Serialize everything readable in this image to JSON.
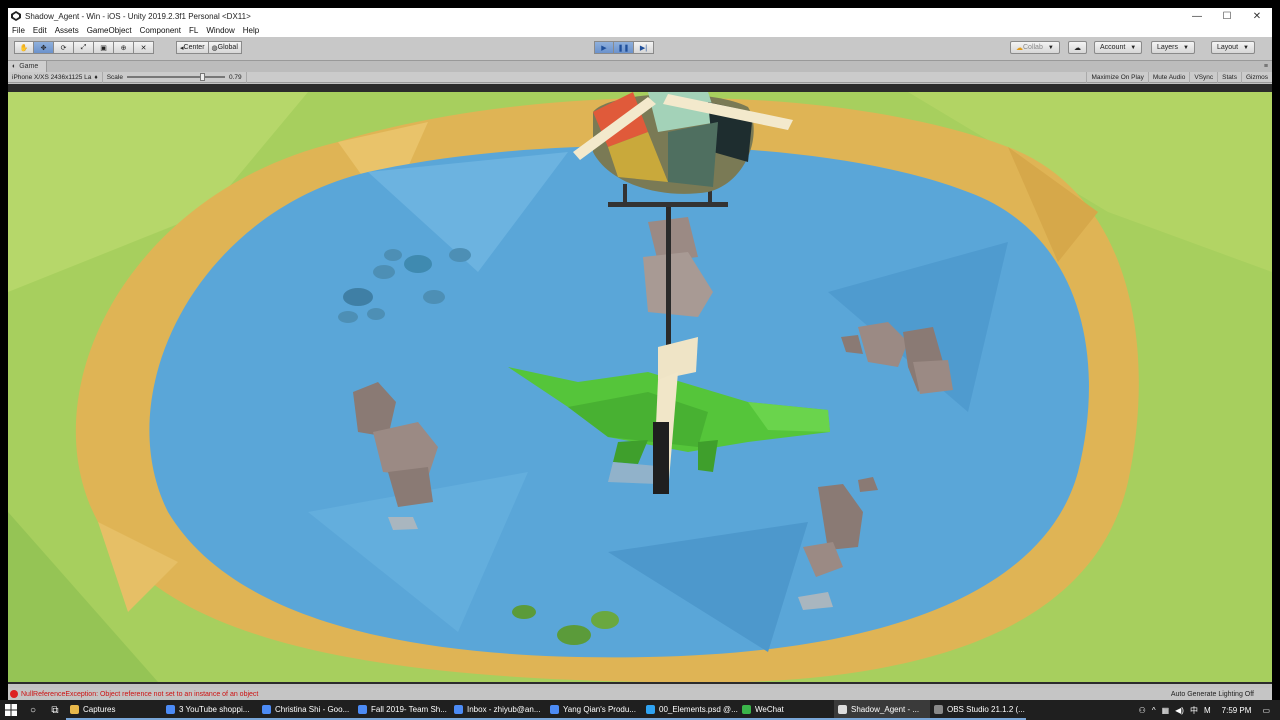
{
  "window": {
    "title": "Shadow_Agent - Win - iOS - Unity 2019.2.3f1 Personal <DX11>",
    "minimize": "—",
    "maximize": "☐",
    "close": "✕"
  },
  "menu": [
    "File",
    "Edit",
    "Assets",
    "GameObject",
    "Component",
    "FL",
    "Window",
    "Help"
  ],
  "toolbar": {
    "pivot_label": "Center",
    "space_label": "Global",
    "collab_label": "Collab",
    "account_label": "Account",
    "layers_label": "Layers",
    "layout_label": "Layout"
  },
  "game_tab": {
    "label": "Game",
    "resolution": "iPhone X/XS 2436x1125 La",
    "scale_label": "Scale",
    "scale_value": "0.79",
    "scale_fraction": 0.79,
    "maximize_on_play": "Maximize On Play",
    "mute_audio": "Mute Audio",
    "vsync": "VSync",
    "stats": "Stats",
    "gizmos": "Gizmos"
  },
  "status": {
    "error": "NullReferenceException: Object reference not set to an instance of an object",
    "lighting": "Auto Generate Lighting Off"
  },
  "taskbar": {
    "items": [
      {
        "label": "Captures",
        "color": "#e8b84a"
      },
      {
        "label": "3 YouTube shoppi...",
        "color": "#4c8bf5"
      },
      {
        "label": "Christina Shi - Goo...",
        "color": "#4c8bf5"
      },
      {
        "label": "Fall 2019- Team Sh...",
        "color": "#4c8bf5"
      },
      {
        "label": "Inbox - zhiyub@an...",
        "color": "#4c8bf5"
      },
      {
        "label": "Yang Qian's Produ...",
        "color": "#4c8bf5"
      },
      {
        "label": "00_Elements.psd @...",
        "color": "#2fa3f2"
      },
      {
        "label": "WeChat",
        "color": "#3ab54a"
      },
      {
        "label": "Shadow_Agent - ...",
        "color": "#dddddd"
      },
      {
        "label": "OBS Studio 21.1.2 (...",
        "color": "#888888"
      }
    ],
    "time": "7:59 PM"
  },
  "colors": {
    "play_accent": "#6b92cc",
    "error": "#cc1111",
    "water": "#5aa6d8",
    "grass": "#9ac95a",
    "sand": "#e0b85a",
    "crocodile": "#52c43a",
    "rock": "#8f7f7a"
  }
}
